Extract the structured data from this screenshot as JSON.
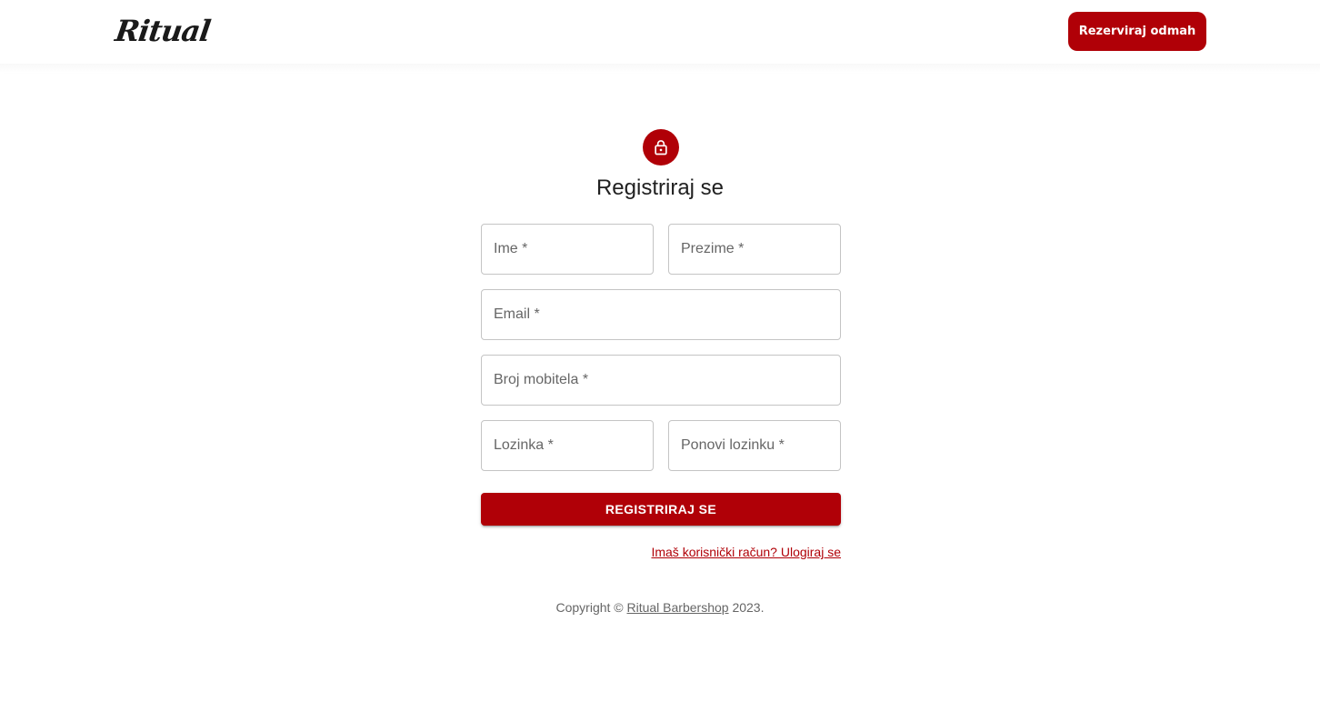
{
  "header": {
    "logo_text": "Ritual",
    "reserve_button": "Rezerviraj odmah"
  },
  "colors": {
    "brand": "#b00007",
    "text": "#212121",
    "muted": "#666666",
    "border": "#c4c4c4"
  },
  "form": {
    "icon": "lock-icon",
    "title": "Registriraj se",
    "fields": {
      "first_name": {
        "placeholder": "Ime *",
        "value": ""
      },
      "last_name": {
        "placeholder": "Prezime *",
        "value": ""
      },
      "email": {
        "placeholder": "Email *",
        "value": ""
      },
      "phone": {
        "placeholder": "Broj mobitela *",
        "value": ""
      },
      "password": {
        "placeholder": "Lozinka *",
        "value": ""
      },
      "password_repeat": {
        "placeholder": "Ponovi lozinku *",
        "value": ""
      }
    },
    "submit_button": "REGISTRIRAJ SE",
    "login_link": "Imaš korisnički račun? Ulogiraj se"
  },
  "footer": {
    "copyright_prefix": "Copyright © ",
    "copyright_link": "Ritual Barbershop",
    "copyright_suffix": " 2023."
  }
}
